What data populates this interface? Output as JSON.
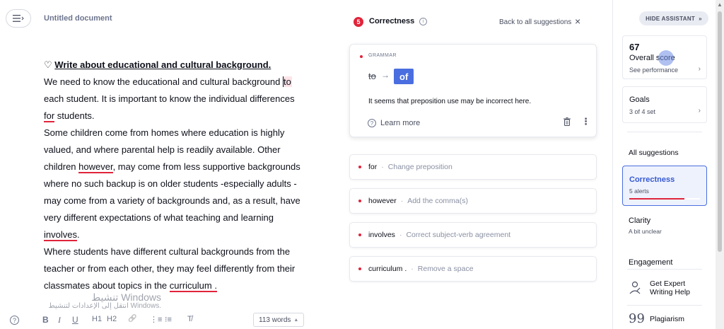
{
  "document": {
    "title": "Untitled document",
    "heading_icon": "♡",
    "heading": "Write about educational and cultural background.",
    "lines": [
      [
        {
          "t": "We need to know the educational and cultural background "
        },
        {
          "t": "to",
          "hl": true
        }
      ],
      [
        {
          "t": "each student. It is important to know the individual differences"
        }
      ],
      [
        {
          "t": "for",
          "u": true
        },
        {
          "t": " students."
        }
      ],
      [
        {
          "t": "Some children come from homes where education is highly"
        }
      ],
      [
        {
          "t": "valued, and where parental help is readily available. Other"
        }
      ],
      [
        {
          "t": "children "
        },
        {
          "t": "however",
          "u": true
        },
        {
          "t": ", may come from less supportive backgrounds"
        }
      ],
      [
        {
          "t": "where no such backup is on older students -especially adults -"
        }
      ],
      [
        {
          "t": "may come from a variety of backgrounds and, as a result, have"
        }
      ],
      [
        {
          "t": "very different expectations of what teaching and learning"
        }
      ],
      [
        {
          "t": "involves",
          "u": true
        },
        {
          "t": "."
        }
      ],
      [
        {
          "t": "Where students have different cultural backgrounds from the"
        }
      ],
      [
        {
          "t": "teacher or from each other, they may feel differently from their"
        }
      ],
      [
        {
          "t": "classmates about topics in the "
        },
        {
          "t": "curriculum .",
          "u": true
        }
      ]
    ],
    "word_count": "113 words"
  },
  "watermark": {
    "line1": "تنشيط Windows",
    "line2": "انتقل إلى الإعدادات لتنشيط Windows."
  },
  "toolbar": {
    "help": "?",
    "bold": "B",
    "italic": "I",
    "underline": "U",
    "h1": "H1",
    "h2": "H2",
    "link": "🔗",
    "ordered_list": "⋮≡",
    "bullet_list": "⁝≡",
    "clear": "T̸"
  },
  "suggestions": {
    "count": "5",
    "title": "Correctness",
    "back_label": "Back to all suggestions",
    "close": "×",
    "active": {
      "category": "GRAMMAR",
      "old": "to",
      "new": "of",
      "explanation": "It seems that preposition use may be incorrect here.",
      "learn_more": "Learn more"
    },
    "items": [
      {
        "word": "for",
        "sep": "·",
        "desc": "Change preposition"
      },
      {
        "word": "however",
        "sep": "·",
        "desc": "Add the comma(s)"
      },
      {
        "word": "involves",
        "sep": "·",
        "desc": "Correct subject-verb agreement"
      },
      {
        "word": "curriculum .",
        "sep": "·",
        "desc": "Remove a space"
      }
    ]
  },
  "sidebar": {
    "hide_label": "HIDE ASSISTANT",
    "score": "67",
    "score_label": "Overall score",
    "score_sub": "See performance",
    "goals_label": "Goals",
    "goals_sub": "3 of 4 set",
    "all_suggestions": "All suggestions",
    "correctness_label": "Correctness",
    "correctness_sub": "5 alerts",
    "correctness_progress": 0.78,
    "clarity_label": "Clarity",
    "clarity_sub": "A bit unclear",
    "engagement_label": "Engagement",
    "expert_label": "Get Expert Writing Help",
    "plagiarism_label": "Plagiarism"
  },
  "colors": {
    "accent": "#4a6ee0",
    "error": "#e0243a"
  }
}
